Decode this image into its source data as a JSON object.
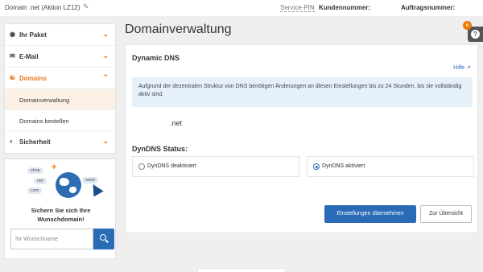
{
  "topbar": {
    "domain": "Domain .net (Aktion LZ12)",
    "service_pin": "Service-PIN",
    "customer_number": "Kundennummer:",
    "order_number": "Auftragsnummer:"
  },
  "sidebar": {
    "items": [
      {
        "label": "Ihr Paket",
        "icon": "package-icon"
      },
      {
        "label": "E-Mail",
        "icon": "mail-icon"
      },
      {
        "label": "Domains",
        "icon": "globe-icon"
      },
      {
        "label": "Sicherheit",
        "icon": "shield-icon"
      }
    ],
    "subitems": [
      {
        "label": "Domainverwaltung"
      },
      {
        "label": "Domains bestellen"
      }
    ]
  },
  "promo": {
    "tags": [
      "shop",
      "net",
      "com",
      "www"
    ],
    "text_line1": "Sichern Sie sich Ihre",
    "text_line2": "Wunschdomain!",
    "placeholder": "Ihr Wunschname"
  },
  "main": {
    "title": "Domainverwaltung",
    "panel_title": "Dynamic DNS",
    "help_link": "Hilfe",
    "info_text": "Aufgrund der dezentralen Struktur von DNS benötigen Änderungen an diesen Einstellungen bis zu 24 Stunden, bis sie vollständig aktiv sind.",
    "domain": ".net",
    "status_title": "DynDNS Status:",
    "option_off": "DynDNS deaktiviert",
    "option_on": "DynDNS aktiviert",
    "apply_button": "Einstellungen übernehmen",
    "back_button": "Zur Übersicht"
  },
  "help_widget": {
    "badge": "6",
    "label": "?"
  },
  "colors": {
    "accent": "#f07800",
    "primary": "#2a6bb6",
    "info_bg": "#e5f0f8"
  }
}
